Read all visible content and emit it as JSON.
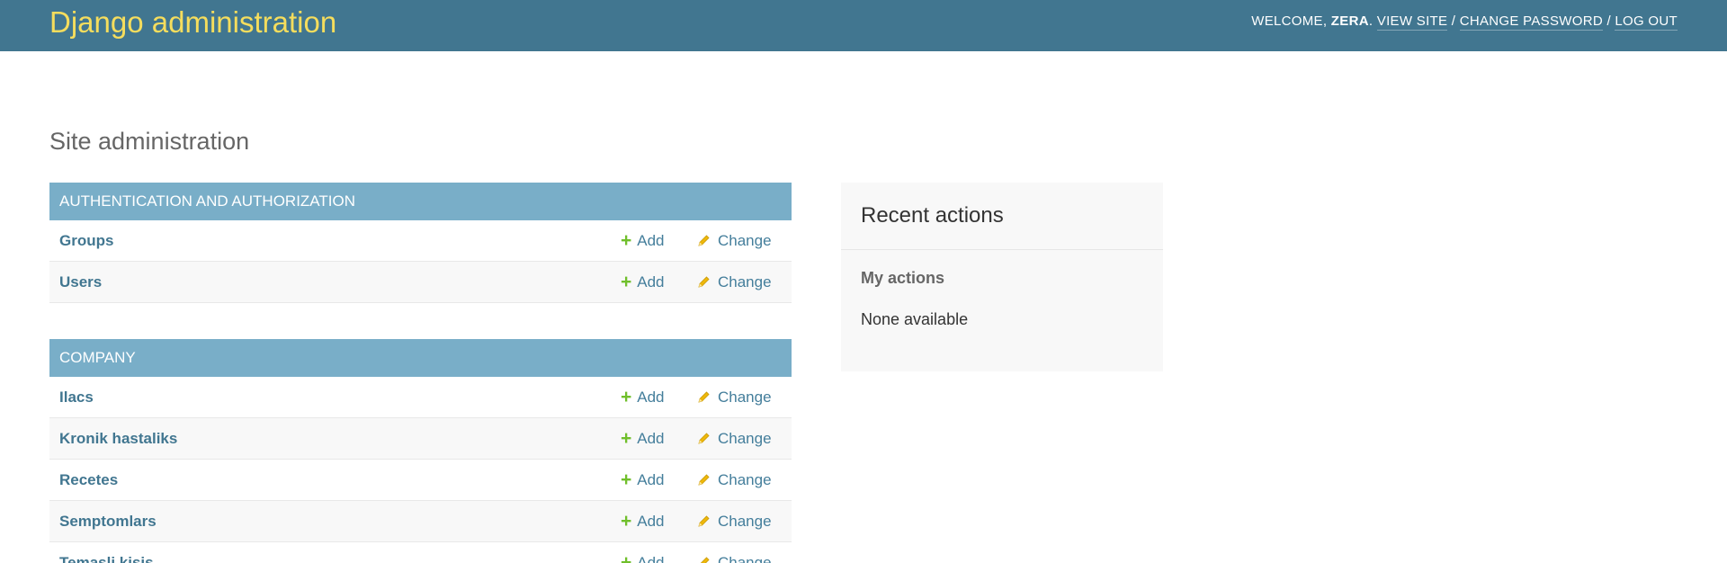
{
  "header": {
    "site_name": "Django administration",
    "welcome_prefix": "Welcome,",
    "username": "ZERA",
    "welcome_suffix": ".",
    "view_site": "View site",
    "change_password": "Change password",
    "log_out": "Log out",
    "separator": " / "
  },
  "page": {
    "title": "Site administration"
  },
  "modules": [
    {
      "caption": "Authentication and Authorization",
      "models": [
        {
          "name": "Groups",
          "add": "Add",
          "change": "Change"
        },
        {
          "name": "Users",
          "add": "Add",
          "change": "Change"
        }
      ]
    },
    {
      "caption": "Company",
      "models": [
        {
          "name": "Ilacs",
          "add": "Add",
          "change": "Change"
        },
        {
          "name": "Kronik hastaliks",
          "add": "Add",
          "change": "Change"
        },
        {
          "name": "Recetes",
          "add": "Add",
          "change": "Change"
        },
        {
          "name": "Semptomlars",
          "add": "Add",
          "change": "Change"
        },
        {
          "name": "Temasli kisis",
          "add": "Add",
          "change": "Change"
        }
      ]
    }
  ],
  "recent_actions": {
    "title": "Recent actions",
    "subtitle": "My actions",
    "empty_text": "None available"
  },
  "icons": {
    "add": "plus-icon",
    "change": "pencil-icon"
  },
  "colors": {
    "header_bg": "#417690",
    "brand": "#f5dd5d",
    "caption_bg": "#79aec8",
    "link": "#417690",
    "add_icon": "#70bf2b",
    "change_icon": "#efb80b"
  }
}
